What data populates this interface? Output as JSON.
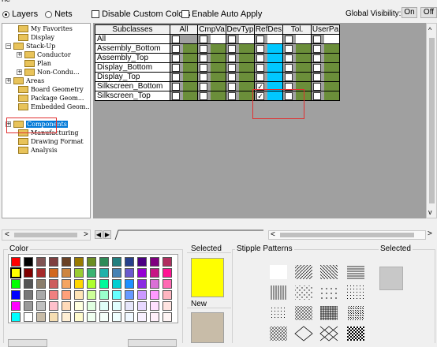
{
  "topbar": {
    "fragment": "ne",
    "radio_layers": "Layers",
    "radio_nets": "Nets",
    "disable_custom_colors": "Disable Custom Colors",
    "enable_auto_apply": "Enable Auto Apply",
    "global_visibility": "Global Visibility:",
    "on_label": "On",
    "off_label": "Off"
  },
  "tree": {
    "items": [
      {
        "label": "My Favorites"
      },
      {
        "label": "Display"
      },
      {
        "label": "Stack-Up"
      },
      {
        "label": "Conductor"
      },
      {
        "label": "Plan"
      },
      {
        "label": "Non-Condu..."
      },
      {
        "label": "Areas"
      },
      {
        "label": "Board Geometry"
      },
      {
        "label": "Package Geom..."
      },
      {
        "label": "Embedded Geom..."
      },
      {
        "label": "Components"
      },
      {
        "label": "Manufacturing"
      },
      {
        "label": "Drawing Format"
      },
      {
        "label": "Analysis"
      }
    ]
  },
  "grid": {
    "headers": [
      "Subclasses",
      "All",
      "CmpVa",
      "DevTyp",
      "RefDes",
      "Tol.",
      "UserPa"
    ],
    "rows": [
      {
        "name": "All"
      },
      {
        "name": "Assembly_Bottom"
      },
      {
        "name": "Assembly_Top"
      },
      {
        "name": "Display_Bottom"
      },
      {
        "name": "Display_Top"
      },
      {
        "name": "Silkscreen_Bottom"
      },
      {
        "name": "Silkscreen_Top"
      }
    ],
    "checked_column": "RefDes",
    "checked_rows": [
      "Silkscreen_Bottom",
      "Silkscreen_Top"
    ],
    "colors": {
      "green": "#6b8e3a",
      "cyan": "#00c8ff",
      "gray": "#a0a0a0"
    }
  },
  "bottom": {
    "color_label": "Color",
    "selected_label": "Selected",
    "new_label": "New",
    "stipple_label": "Stipple Patterns",
    "stipple_selected_label": "Selected",
    "selected_color": "#ffff00",
    "new_color": "#c8bca8"
  }
}
